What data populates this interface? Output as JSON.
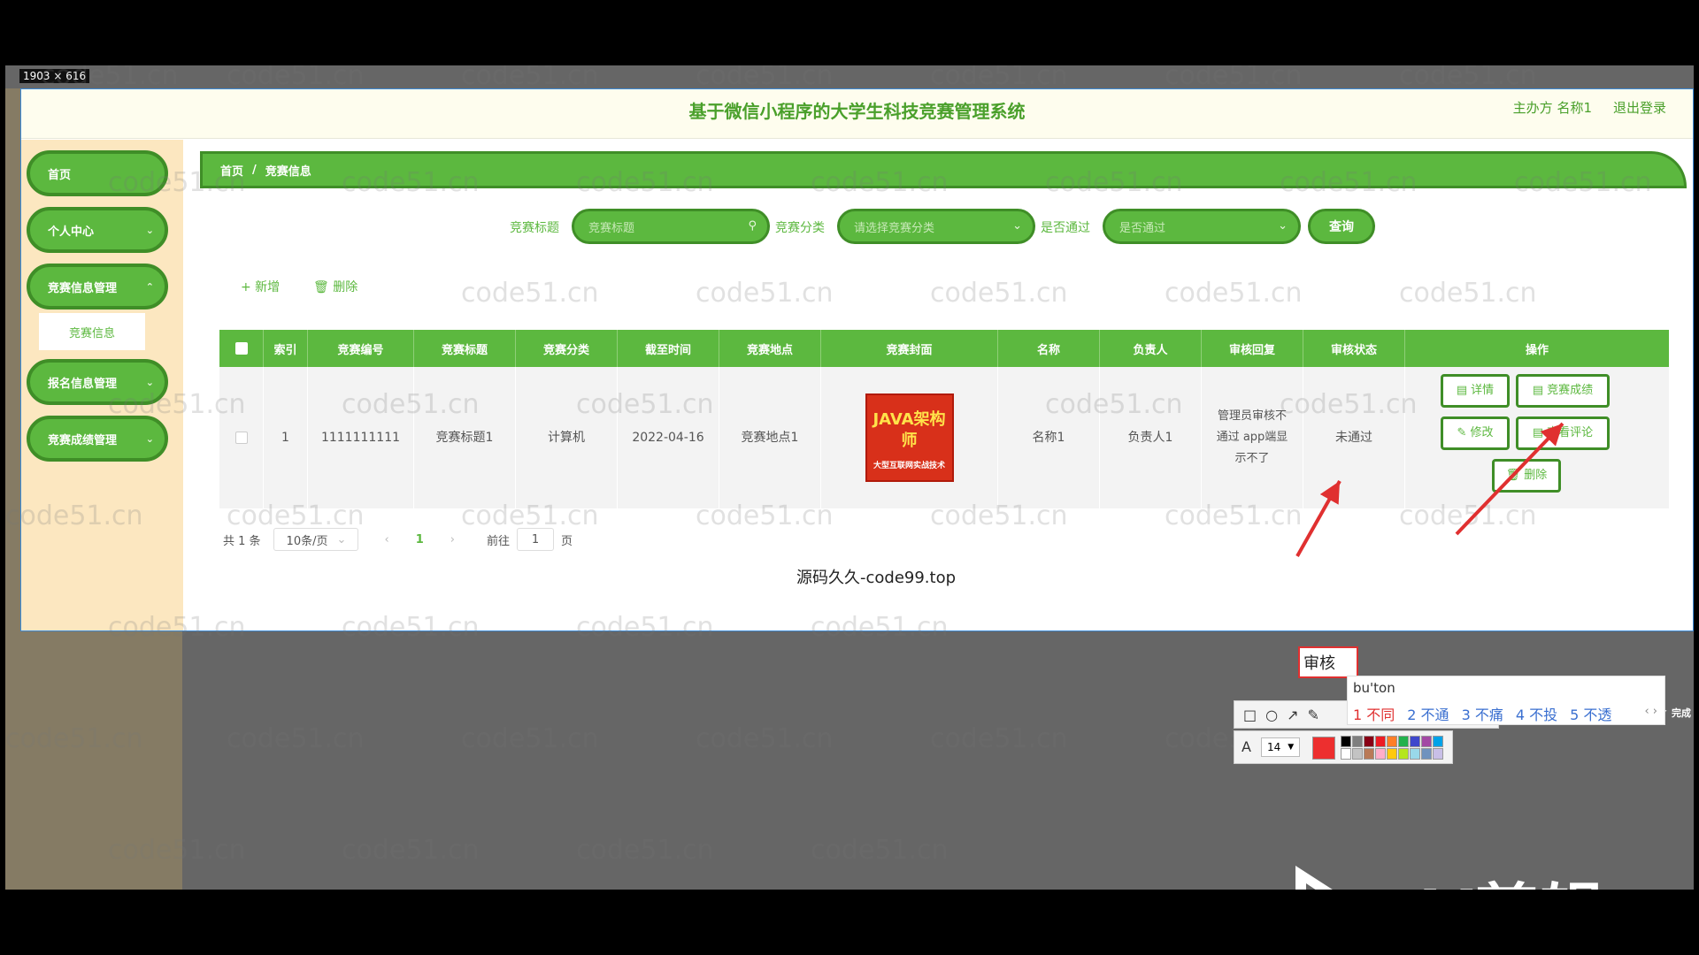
{
  "overlay": {
    "dimensions": "1903 × 616",
    "watermark": "code51.cn",
    "source_stamp": "源码久久-code99.top",
    "annotation_text": "审核",
    "ime_input": "bu'ton",
    "ime_candidates": [
      "1 不同",
      "2 不通",
      "3 不痛",
      "4 不投",
      "5 不透"
    ],
    "ime_nav": "‹ ›",
    "font_size": "14",
    "done_label": "✓ 完成",
    "arrow_color": "#e03030",
    "palette": [
      "#000000",
      "#7f7f7f",
      "#880015",
      "#ed1c24",
      "#ff7f27",
      "#22b14c",
      "#3f48cc",
      "#a349a4",
      "#00a2e8",
      "#ffffff",
      "#c3c3c3",
      "#b97a57",
      "#ffaec9",
      "#ffc90e",
      "#b5e61d",
      "#99d9ea",
      "#7092be",
      "#c8bfe7"
    ],
    "ev_logo": "eV剪辑"
  },
  "header": {
    "title": "基于微信小程序的大学生科技竞赛管理系统",
    "user": "主办方 名称1",
    "logout": "退出登录"
  },
  "sidebar": {
    "items": [
      {
        "label": "首页",
        "has_chevron": false
      },
      {
        "label": "个人中心",
        "has_chevron": true
      },
      {
        "label": "竞赛信息管理",
        "has_chevron": true
      },
      {
        "label": "报名信息管理",
        "has_chevron": true
      },
      {
        "label": "竞赛成绩管理",
        "has_chevron": true
      }
    ],
    "sub_item": "竞赛信息"
  },
  "breadcrumb": {
    "home": "首页",
    "sep": "/",
    "current": "竞赛信息"
  },
  "search": {
    "title_label": "竞赛标题",
    "title_placeholder": "竞赛标题",
    "category_label": "竞赛分类",
    "category_placeholder": "请选择竞赛分类",
    "pass_label": "是否通过",
    "pass_placeholder": "是否通过",
    "query_button": "查询"
  },
  "toolbar": {
    "add": "+ 新增",
    "delete": "删除"
  },
  "table": {
    "columns": [
      "",
      "索引",
      "竞赛编号",
      "竞赛标题",
      "竞赛分类",
      "截至时间",
      "竞赛地点",
      "竞赛封面",
      "名称",
      "负责人",
      "审核回复",
      "审核状态",
      "操作"
    ],
    "row": {
      "index": "1",
      "number": "1111111111",
      "title": "竞赛标题1",
      "category": "计算机",
      "deadline": "2022-04-16",
      "location": "竞赛地点1",
      "cover_title": "JAVA架构师",
      "cover_sub": "大型互联网实战技术",
      "name": "名称1",
      "owner": "负责人1",
      "reply": "管理员审核不通过 app端显示不了",
      "status": "未通过"
    },
    "actions": [
      "详情",
      "竞赛成绩",
      "修改",
      "查看评论",
      "删除"
    ]
  },
  "pager": {
    "total": "共 1 条",
    "page_size": "10条/页",
    "prev": "‹",
    "current": "1",
    "next": "›",
    "goto": "前往",
    "goto_value": "1",
    "page_unit": "页"
  }
}
